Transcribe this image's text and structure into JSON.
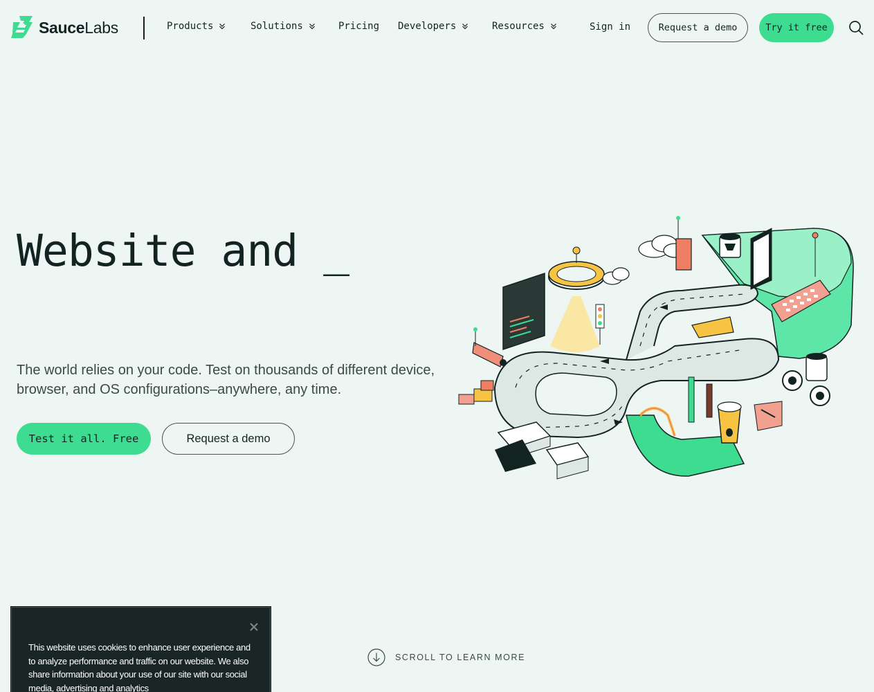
{
  "brand": {
    "name_bold": "Sauce",
    "name_light": "Labs",
    "accent": "#3ddc91",
    "dark": "#132322"
  },
  "nav": {
    "items": [
      {
        "label": "Products",
        "dropdown": true
      },
      {
        "label": "Solutions",
        "dropdown": true
      },
      {
        "label": "Pricing",
        "dropdown": false
      },
      {
        "label": "Developers",
        "dropdown": true
      },
      {
        "label": "Resources",
        "dropdown": true
      }
    ],
    "sign_in": "Sign in",
    "request_demo": "Request a demo",
    "try_free": "Try it free",
    "search_icon": "search-icon"
  },
  "hero": {
    "title": "Website and _",
    "subtitle": "The world relies on your code. Test on thousands of different device, browser, and OS configurations–anywhere, any time.",
    "primary_cta": "Test it all. Free",
    "secondary_cta": "Request a demo"
  },
  "scroll_hint": {
    "label": "SCROLL TO LEARN MORE",
    "icon": "arrow-down-circle-icon"
  },
  "cookie_banner": {
    "text": "This website uses cookies to enhance user experience and to analyze performance and traffic on our website. We also share information about your use of our site with our social media, advertising and analytics",
    "close_icon": "close-icon"
  }
}
